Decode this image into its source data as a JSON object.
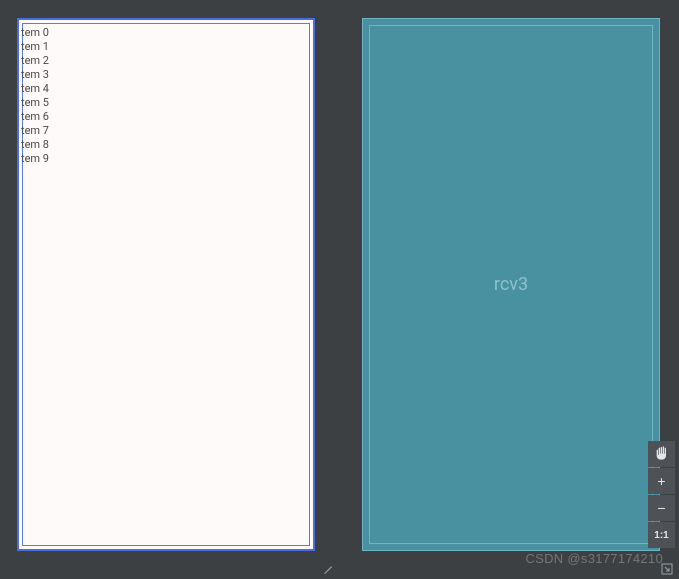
{
  "left_panel": {
    "items": [
      "tem 0",
      "tem 1",
      "tem 2",
      "tem 3",
      "tem 4",
      "tem 5",
      "tem 6",
      "tem 7",
      "tem 8",
      "tem 9"
    ]
  },
  "right_panel": {
    "label": "rcv3"
  },
  "watermark": "CSDN @s3177174210",
  "toolbar": {
    "pan_icon": "hand-icon",
    "zoom_in": "+",
    "zoom_out": "−",
    "ratio": "1:1"
  }
}
